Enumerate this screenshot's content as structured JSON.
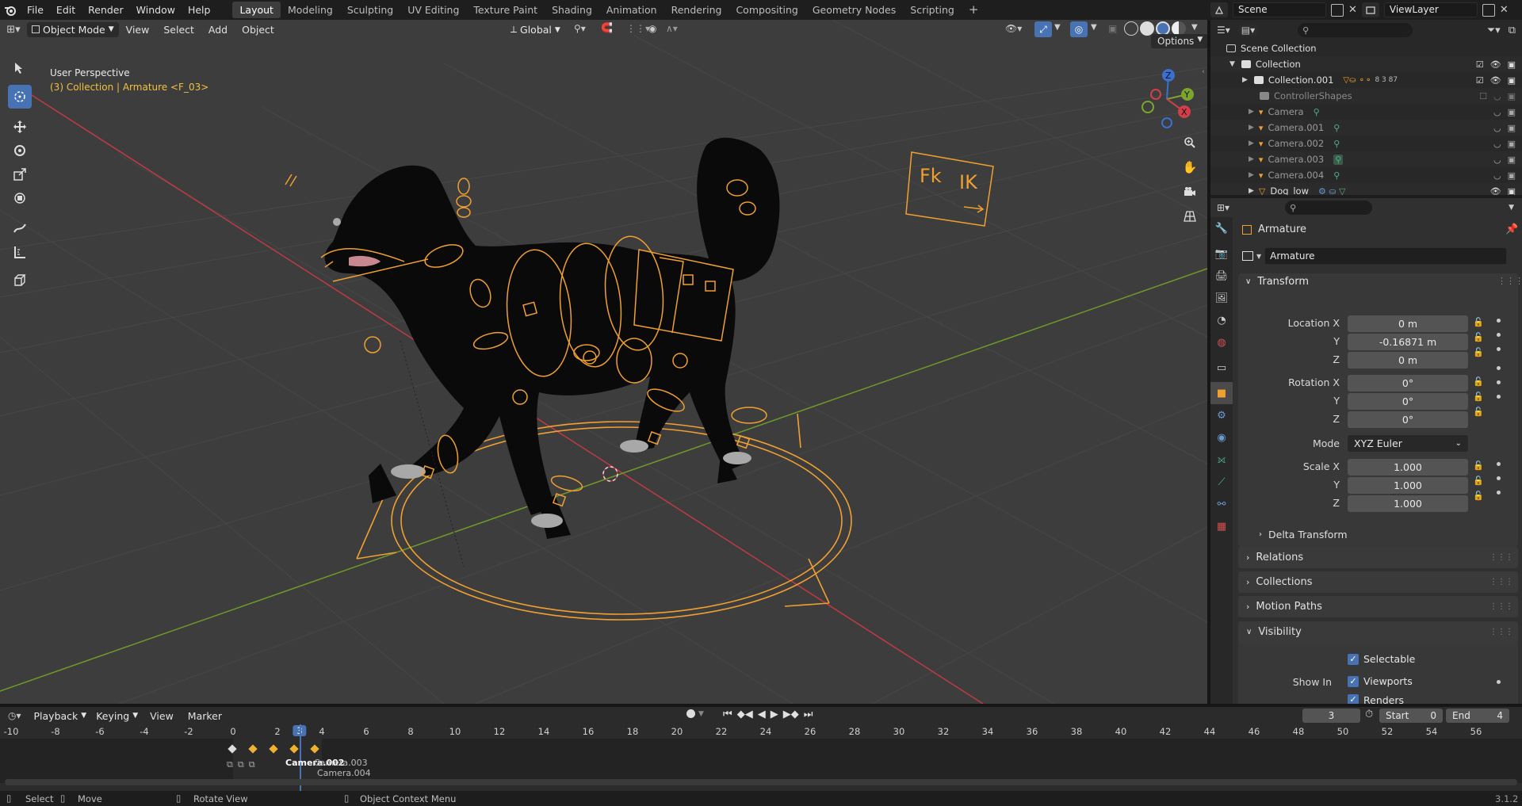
{
  "topbar": {
    "menus": [
      "File",
      "Edit",
      "Render",
      "Window",
      "Help"
    ],
    "workspaces": [
      "Layout",
      "Modeling",
      "Sculpting",
      "UV Editing",
      "Texture Paint",
      "Shading",
      "Animation",
      "Rendering",
      "Compositing",
      "Geometry Nodes",
      "Scripting"
    ],
    "active_workspace": "Layout",
    "scene": "Scene",
    "view_layer": "ViewLayer"
  },
  "viewport": {
    "mode": "Object Mode",
    "menus": [
      "View",
      "Select",
      "Add",
      "Object"
    ],
    "orientation": "Global",
    "options": "Options",
    "overlay_title": "User Perspective",
    "overlay_subtitle": "(3) Collection | Armature <F_03>",
    "gizmo_axes": [
      "Z",
      "Y",
      "X"
    ],
    "rig_label_fk": "Fk",
    "rig_label_ik": "IK"
  },
  "outliner": {
    "root": "Scene Collection",
    "items": [
      {
        "name": "Collection",
        "badge": ""
      },
      {
        "name": "Collection.001",
        "badge": "8 3 87"
      },
      {
        "name": "ControllerShapes",
        "badge": ""
      },
      {
        "name": "Camera",
        "badge": ""
      },
      {
        "name": "Camera.001",
        "badge": ""
      },
      {
        "name": "Camera.002",
        "badge": ""
      },
      {
        "name": "Camera.003",
        "badge": ""
      },
      {
        "name": "Camera.004",
        "badge": ""
      },
      {
        "name": "Dog_low",
        "badge": ""
      }
    ]
  },
  "properties": {
    "breadcrumb": "Armature",
    "object_name": "Armature",
    "transform_title": "Transform",
    "location_label": "Location X",
    "rotation_label": "Rotation X",
    "scale_label": "Scale X",
    "axis_y": "Y",
    "axis_z": "Z",
    "location": [
      "0 m",
      "-0.16871 m",
      "0 m"
    ],
    "rotation": [
      "0°",
      "0°",
      "0°"
    ],
    "mode_label": "Mode",
    "mode_value": "XYZ Euler",
    "scale": [
      "1.000",
      "1.000",
      "1.000"
    ],
    "delta_transform": "Delta Transform",
    "relations": "Relations",
    "collections": "Collections",
    "motion_paths": "Motion Paths",
    "visibility": "Visibility",
    "selectable": "Selectable",
    "show_in": "Show In",
    "viewports": "Viewports",
    "renders": "Renders"
  },
  "timeline": {
    "menus": [
      "Playback",
      "Keying",
      "View",
      "Marker"
    ],
    "current_frame": "3",
    "start_label": "Start",
    "start": "0",
    "end_label": "End",
    "end": "4",
    "ticks": [
      "-10",
      "-8",
      "-6",
      "-4",
      "-2",
      "0",
      "2",
      "3",
      "4",
      "6",
      "8",
      "10",
      "12",
      "14",
      "16",
      "18",
      "20",
      "22",
      "24",
      "26",
      "28",
      "30",
      "32",
      "34",
      "36",
      "38",
      "40",
      "42",
      "44",
      "46",
      "48",
      "50",
      "52",
      "54",
      "56"
    ],
    "markers": [
      "Camera.002",
      "Camera.003",
      "Camera.004"
    ]
  },
  "statusbar": {
    "select": "Select",
    "move": "Move",
    "rotate_view": "Rotate View",
    "context_menu": "Object Context Menu",
    "version": "3.1.2"
  },
  "colors": {
    "accent": "#4772b3",
    "selected_orange": "#f0a030",
    "viewport_bg": "#3d3d3d",
    "x_axis": "#c03a44",
    "y_axis": "#6f9a28"
  }
}
